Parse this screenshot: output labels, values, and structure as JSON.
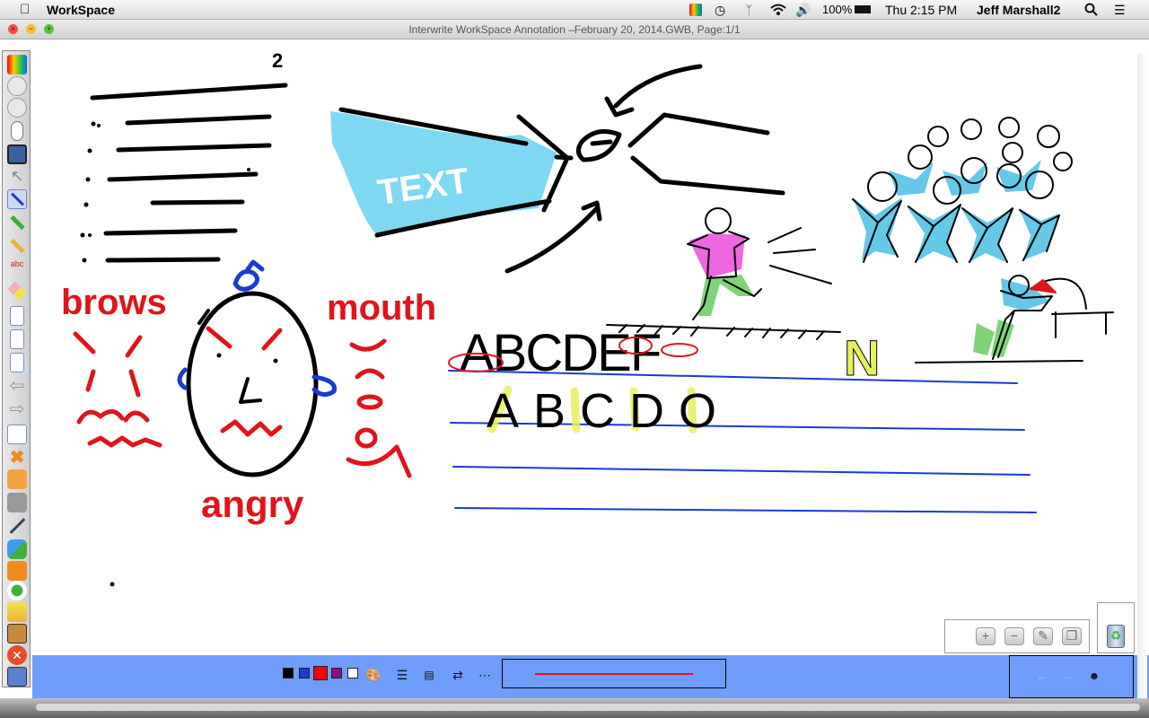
{
  "menubar": {
    "app_name": "WorkSpace",
    "battery": "100%",
    "clock": "Thu 2:15 PM",
    "user": "Jeff Marshall2"
  },
  "window": {
    "title": "Interwrite WorkSpace Annotation –February 20, 2014.GWB, Page:1/1"
  },
  "annotation": {
    "superscript": "2",
    "banner_text": "TEXT",
    "label_brows": "brows",
    "label_mouth": "mouth",
    "label_angry": "angry",
    "letters_top": "ABCDEF",
    "letters_bottom": "ABCDO",
    "letter_n": "N"
  },
  "palette": {
    "colors": [
      "#000000",
      "#1a3ad6",
      "#ff0000",
      "#8a0f8a",
      "#ffffff"
    ],
    "selected_index": 2,
    "pen_preview_color": "#e0141b"
  },
  "colors": {
    "ink_black": "#000000",
    "ink_red": "#e0141b",
    "ink_blue": "#1a3ad6",
    "highlight_cyan": "#64c8e8",
    "highlight_yellow": "#e6f05a",
    "highlight_pink": "#ee66e0",
    "highlight_green": "#7fd47a",
    "bar_blue": "#6e9dfb"
  },
  "icons": {
    "toolbar": [
      "palette-icon",
      "circle-icon",
      "circle-down-icon",
      "mouse-icon",
      "floppy-disk-icon",
      "arrow-pointer-icon",
      "pen-icon",
      "highlighter-icon",
      "marker-icon",
      "spell-check-icon",
      "eraser-icon",
      "page-icon",
      "page-list-icon",
      "pages-icon",
      "left-arrow-icon",
      "right-arrow-icon",
      "list-icon",
      "clear-icon",
      "undo-icon",
      "redo-icon",
      "line-tool-icon",
      "shapes-icon",
      "fill-icon",
      "spotlight-icon",
      "reveal-icon",
      "keyboard-icon",
      "close-circle-icon",
      "export-icon"
    ],
    "zoom_panel": [
      "zoom-in-icon",
      "zoom-out-icon",
      "page-edit-icon",
      "copy-page-icon"
    ],
    "nav": [
      "back-arrow-icon",
      "forward-arrow-icon",
      "people-icon"
    ]
  }
}
